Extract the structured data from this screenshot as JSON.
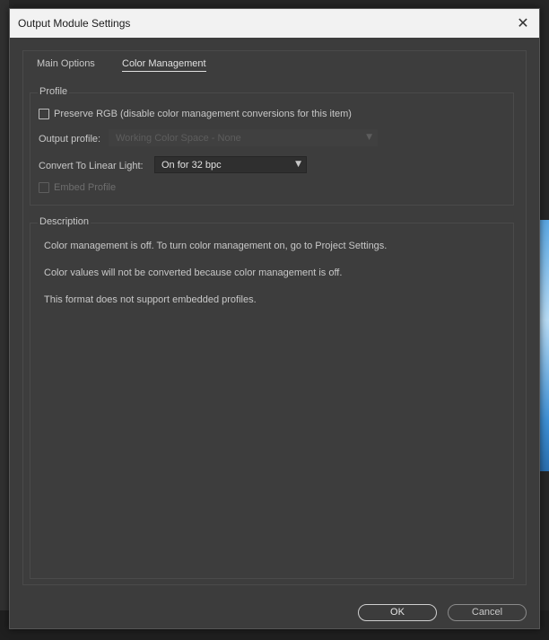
{
  "dialog": {
    "title": "Output Module Settings",
    "close_icon": "close-icon"
  },
  "tabs": [
    {
      "label": "Main Options",
      "active": false
    },
    {
      "label": "Color Management",
      "active": true
    }
  ],
  "profile": {
    "group_title": "Profile",
    "preserve_rgb_label": "Preserve RGB (disable color management conversions for this item)",
    "preserve_rgb_checked": false,
    "output_profile_label": "Output profile:",
    "output_profile_value": "Working Color Space - None",
    "convert_linear_label": "Convert To Linear Light:",
    "convert_linear_value": "On for 32 bpc",
    "embed_profile_label": "Embed Profile",
    "embed_profile_checked": false
  },
  "description": {
    "group_title": "Description",
    "lines": [
      "Color management is off. To turn color management on, go to Project Settings.",
      "Color values will not be converted because color management is off.",
      "This format does not support embedded profiles."
    ]
  },
  "buttons": {
    "ok_label": "OK",
    "cancel_label": "Cancel"
  }
}
